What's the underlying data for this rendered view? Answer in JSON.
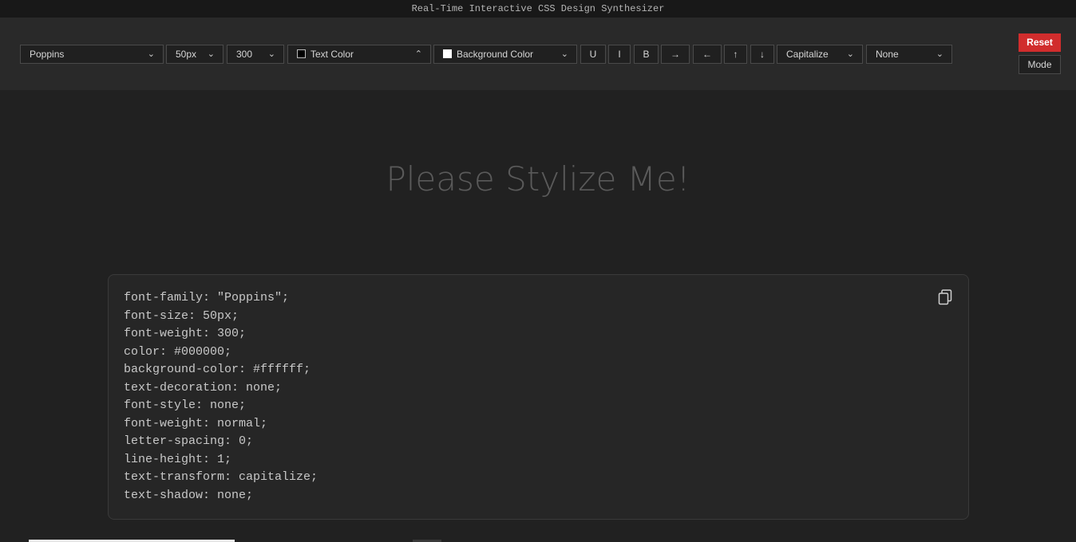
{
  "app": {
    "title": "Real-Time Interactive CSS Design Synthesizer"
  },
  "toolbar": {
    "font_family": "Poppins",
    "font_size": "50px",
    "font_weight": "300",
    "text_color_label": "Text Color",
    "background_color_label": "Background Color",
    "underline_label": "U",
    "italic_label": "I",
    "bold_label": "B",
    "arrow_right": "→",
    "arrow_left": "←",
    "arrow_up": "↑",
    "arrow_down": "↓",
    "text_transform": "Capitalize",
    "text_shadow": "None",
    "reset_label": "Reset",
    "mode_label": "Mode"
  },
  "preview": {
    "text": "Please Stylize Me!"
  },
  "css_output": [
    "font-family: \"Poppins\";",
    "font-size: 50px;",
    "font-weight: 300;",
    "color: #000000;",
    "background-color: #ffffff;",
    "text-decoration: none;",
    "font-style: none;",
    "font-weight: normal;",
    "letter-spacing: 0;",
    "line-height: 1;",
    "text-transform: capitalize;",
    "text-shadow: none;"
  ],
  "colors": {
    "accent": "#d12d2d",
    "background": "#212121",
    "toolbar": "#292929"
  },
  "icons": {
    "copy": "copy-icon",
    "dropdown": "chevron-down-icon",
    "dropdown_open": "chevron-up-icon"
  }
}
